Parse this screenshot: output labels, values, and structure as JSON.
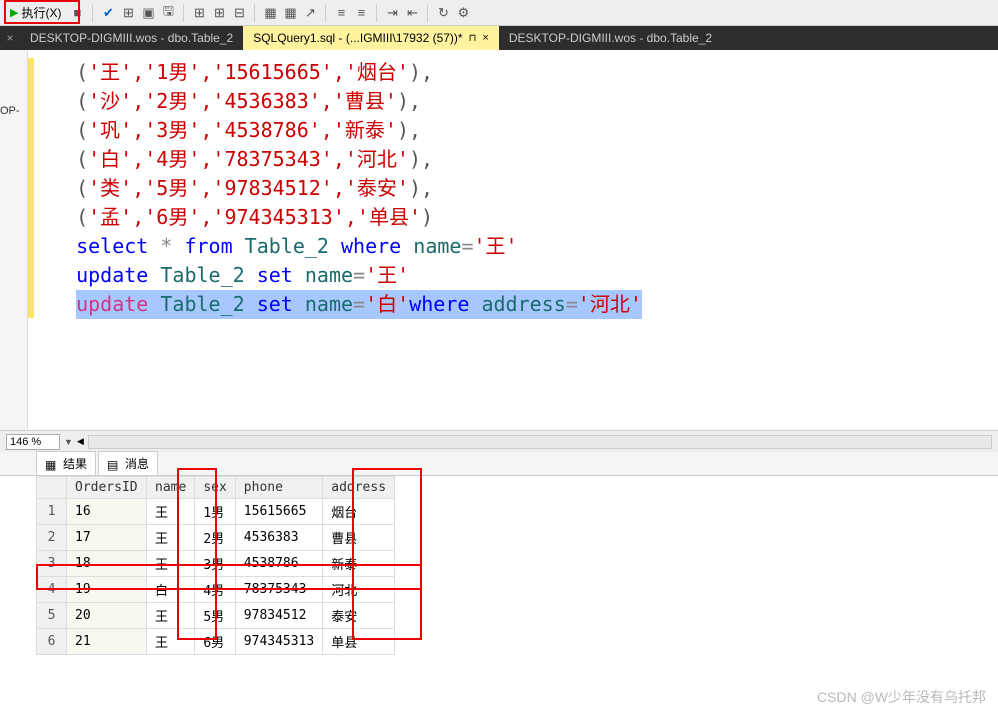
{
  "toolbar": {
    "execute_label": "执行(X)"
  },
  "tabs": {
    "t1": "DESKTOP-DIGMIII.wos - dbo.Table_2",
    "t2": "SQLQuery1.sql - (...IGMIII\\17932 (57))*",
    "t3": "DESKTOP-DIGMIII.wos - dbo.Table_2"
  },
  "left_label": "OP-",
  "code": {
    "l1": {
      "a": "('",
      "v1": "王",
      "b": "','",
      "v2": "1男",
      "c": "','",
      "v3": "15615665",
      "d": "','",
      "v4": "烟台",
      "e": "'),"
    },
    "l2": {
      "a": "('",
      "v1": "沙",
      "b": "','",
      "v2": "2男",
      "c": "','",
      "v3": "4536383",
      "d": "','",
      "v4": "曹县",
      "e": "'),"
    },
    "l3": {
      "a": "('",
      "v1": "巩",
      "b": "','",
      "v2": "3男",
      "c": "','",
      "v3": "4538786",
      "d": "','",
      "v4": "新泰",
      "e": "'),"
    },
    "l4": {
      "a": "('",
      "v1": "白",
      "b": "','",
      "v2": "4男",
      "c": "','",
      "v3": "78375343",
      "d": "','",
      "v4": "河北",
      "e": "'),"
    },
    "l5": {
      "a": "('",
      "v1": "类",
      "b": "','",
      "v2": "5男",
      "c": "','",
      "v3": "97834512",
      "d": "','",
      "v4": "泰安",
      "e": "'),"
    },
    "l6": {
      "a": "('",
      "v1": "孟",
      "b": "','",
      "v2": "6男",
      "c": "','",
      "v3": "974345313",
      "d": "','",
      "v4": "单县",
      "e": "')"
    },
    "sel": {
      "k1": "select",
      "star": " * ",
      "k2": "from",
      "t": " Table_2 ",
      "k3": "where",
      "n": " name",
      "eq": "=",
      "v": "'王'"
    },
    "upd1": {
      "k1": "update",
      "t": " Table_2 ",
      "k2": "set",
      "n": " name",
      "eq": "=",
      "v": "'王'"
    },
    "upd2": {
      "k1": "update",
      "t": " Table_2 ",
      "k2": "set",
      "n": " name",
      "eq": "=",
      "v": "'白'",
      "k3": "where",
      "a": " address",
      "eq2": "=",
      "v2": "'河北'"
    }
  },
  "zoom": "146 %",
  "results": {
    "tab1": "结果",
    "tab2": "消息",
    "headers": {
      "c1": "OrdersID",
      "c2": "name",
      "c3": "sex",
      "c4": "phone",
      "c5": "address"
    },
    "rows": [
      {
        "n": "1",
        "id": "16",
        "name": "王",
        "sex": "1男",
        "phone": "15615665",
        "addr": "烟台"
      },
      {
        "n": "2",
        "id": "17",
        "name": "王",
        "sex": "2男",
        "phone": "4536383",
        "addr": "曹县"
      },
      {
        "n": "3",
        "id": "18",
        "name": "王",
        "sex": "3男",
        "phone": "4538786",
        "addr": "新泰"
      },
      {
        "n": "4",
        "id": "19",
        "name": "白",
        "sex": "4男",
        "phone": "78375343",
        "addr": "河北"
      },
      {
        "n": "5",
        "id": "20",
        "name": "王",
        "sex": "5男",
        "phone": "97834512",
        "addr": "泰安"
      },
      {
        "n": "6",
        "id": "21",
        "name": "王",
        "sex": "6男",
        "phone": "974345313",
        "addr": "单县"
      }
    ]
  },
  "watermark": "CSDN @W少年没有乌托邦"
}
